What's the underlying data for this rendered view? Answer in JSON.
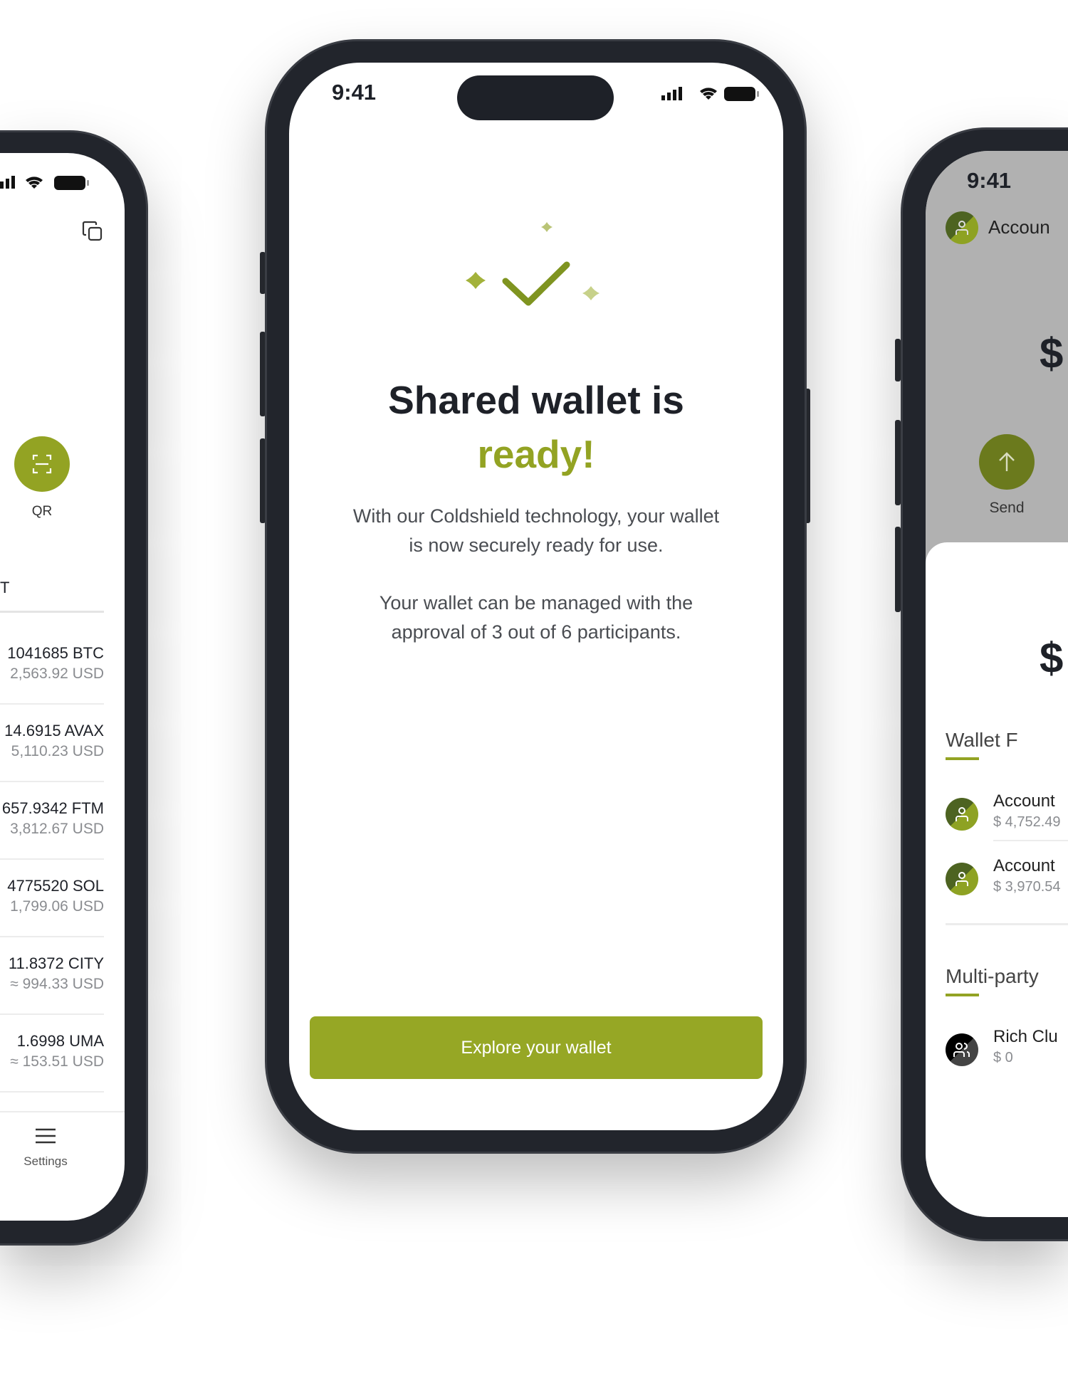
{
  "colors": {
    "accent": "#93a323",
    "dark": "#1e2128",
    "frame": "#22252c"
  },
  "left_phone": {
    "qr_label": "QR",
    "section_label": "T",
    "assets": [
      {
        "amount": "1041685 BTC",
        "usd": "2,563.92 USD"
      },
      {
        "amount": "14.6915 AVAX",
        "usd": "5,110.23 USD"
      },
      {
        "amount": "657.9342 FTM",
        "usd": "3,812.67 USD"
      },
      {
        "amount": "4775520 SOL",
        "usd": "1,799.06 USD"
      },
      {
        "amount": "11.8372 CITY",
        "usd": "≈ 994.33 USD"
      },
      {
        "amount": "1.6998 UMA",
        "usd": "≈ 153.51 USD"
      }
    ],
    "nav_settings": "Settings"
  },
  "center_phone": {
    "time": "9:41",
    "title_line1": "Shared wallet is",
    "title_line2": "ready!",
    "para1_line1": "With our Coldshield technology, your wallet",
    "para1_line2": "is now securely ready for use.",
    "para2_line1": "Your wallet can be managed with the",
    "para2_line2": "approval of 3 out of 6 participants.",
    "button": "Explore your wallet"
  },
  "right_phone": {
    "time": "9:41",
    "account_label": "Accoun",
    "balance_symbol": "$",
    "send_label": "Send",
    "sheet_balance_symbol": "$",
    "wallet_section": "Wallet F",
    "accounts": [
      {
        "name": "Account",
        "balance": "$ 4,752.49"
      },
      {
        "name": "Account",
        "balance": "$ 3,970.54"
      }
    ],
    "multiparty_section": "Multi-party",
    "multiparty": [
      {
        "name": "Rich Clu",
        "balance": "$ 0"
      }
    ]
  }
}
